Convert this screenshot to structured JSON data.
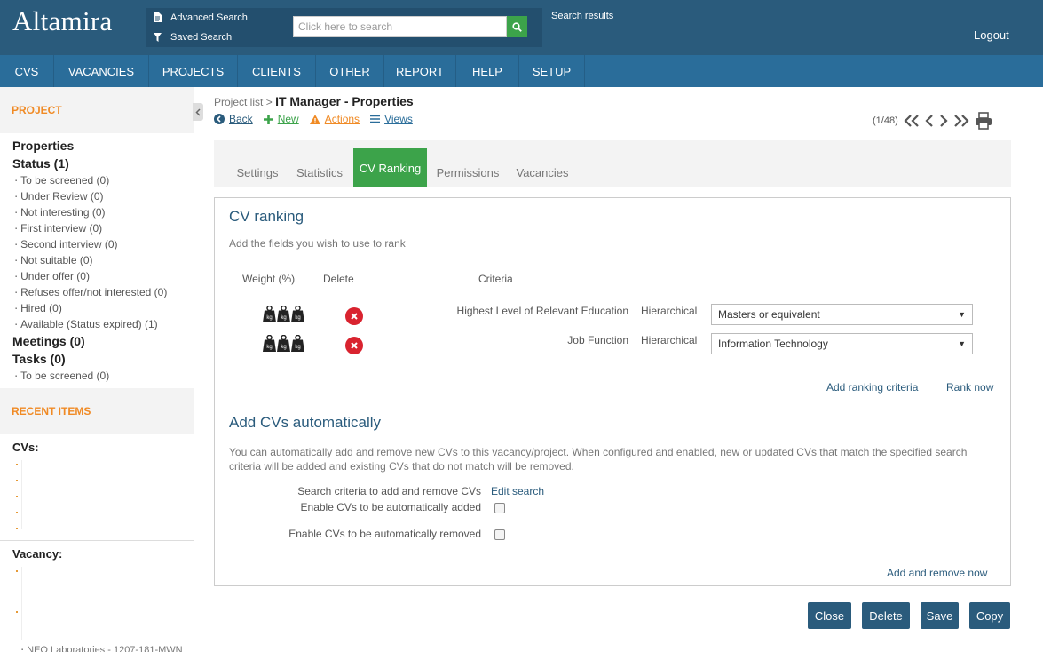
{
  "app": {
    "logo": "Altamira"
  },
  "header": {
    "advanced_search": "Advanced Search",
    "saved_search": "Saved Search",
    "search_placeholder": "Click here to search",
    "search_results": "Search results",
    "logout": "Logout"
  },
  "nav": [
    "CVS",
    "VACANCIES",
    "PROJECTS",
    "CLIENTS",
    "OTHER",
    "REPORT",
    "HELP",
    "SETUP"
  ],
  "sidebar": {
    "project_heading": "PROJECT",
    "project_name": "Properties",
    "status_heading": "Status (1)",
    "status_items": [
      "To be screened (0)",
      "Under Review (0)",
      "Not interesting (0)",
      "First interview (0)",
      "Second interview (0)",
      "Not suitable (0)",
      "Under offer (0)",
      "Refuses offer/not interested (0)",
      "Hired (0)",
      "Available (Status expired) (1)"
    ],
    "meetings": "Meetings (0)",
    "tasks": "Tasks (0)",
    "task_items": [
      "To be screened (0)"
    ],
    "recent_heading": "RECENT ITEMS",
    "cvs_heading": "CVs:",
    "vacancy_heading": "Vacancy:",
    "cut_text": "NEO Laboratories - 1207-181-MWN"
  },
  "breadcrumb": {
    "parent": "Project list",
    "separator": ">",
    "current": "IT Manager - Properties"
  },
  "actions": {
    "back": "Back",
    "new": "New",
    "actions": "Actions",
    "views": "Views"
  },
  "pager": {
    "position": "(1/48)"
  },
  "tabs": [
    "Settings",
    "Statistics",
    "CV Ranking",
    "Permissions",
    "Vacancies"
  ],
  "active_tab": "CV Ranking",
  "ranking": {
    "title": "CV ranking",
    "subtitle": "Add the fields you wish to use to rank",
    "col_weight": "Weight (%)",
    "col_delete": "Delete",
    "col_criteria": "Criteria",
    "criteria": [
      {
        "label": "Highest Level of Relevant Education",
        "type": "Hierarchical",
        "value": "Masters or equivalent",
        "weight_icons": 3
      },
      {
        "label": "Job Function",
        "type": "Hierarchical",
        "value": "Information Technology",
        "weight_icons": 3
      }
    ],
    "add_criteria": "Add ranking criteria",
    "rank_now": "Rank now",
    "kg": "kg"
  },
  "auto": {
    "title": "Add CVs automatically",
    "description": "You can automatically add and remove new CVs to this vacancy/project. When configured and enabled, new or updated CVs that match the specified search criteria will be added and existing CVs that do not match will be removed.",
    "search_criteria_label": "Search criteria to add and remove CVs",
    "edit_search": "Edit search",
    "enable_add_label": "Enable CVs to be automatically added",
    "enable_add_checked": false,
    "enable_remove_label": "Enable CVs to be automatically removed",
    "enable_remove_checked": false,
    "add_remove_now": "Add and remove now"
  },
  "buttons": {
    "close": "Close",
    "delete": "Delete",
    "save": "Save",
    "copy": "Copy"
  },
  "colors": {
    "header": "#2a5b7c",
    "nav": "#2a6d9a",
    "accent_green": "#3ca34a",
    "accent_orange": "#f08a24",
    "delete_red": "#d9232f"
  }
}
